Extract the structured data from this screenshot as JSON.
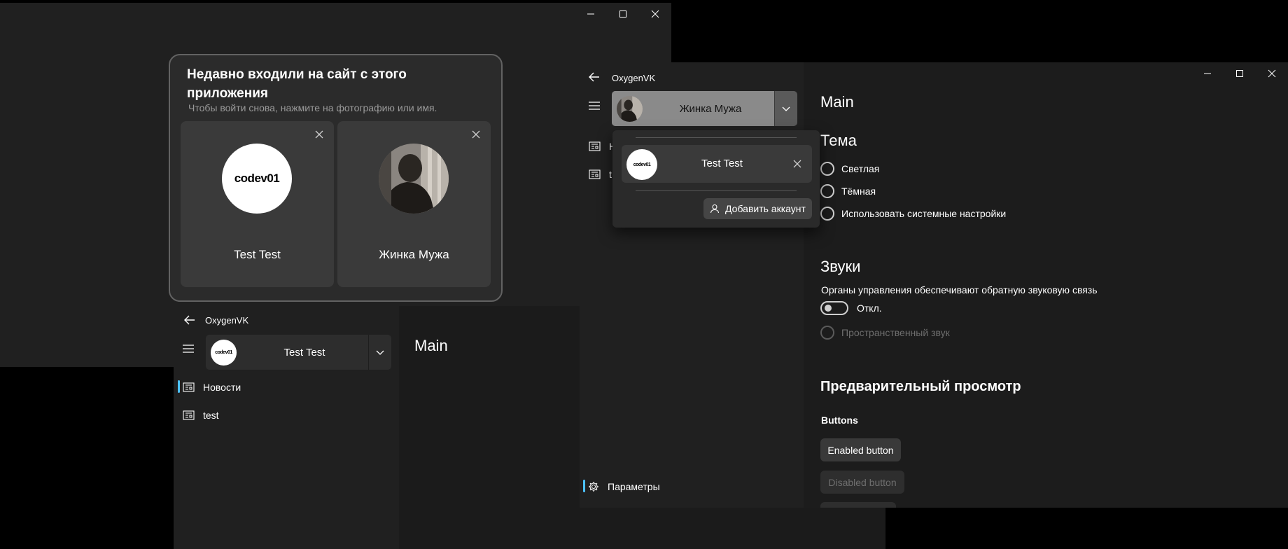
{
  "window1": {
    "caption": {
      "minimize": "minimize-icon",
      "maximize": "maximize-icon",
      "close": "close-icon"
    },
    "login": {
      "title": "Недавно входили на сайт с этого приложения",
      "subtitle": "Чтобы войти снова, нажмите на фотографию или имя.",
      "accounts": [
        {
          "name": "Test Test",
          "avatar_text": "codev01"
        },
        {
          "name": "Жинка Мужа",
          "avatar_text": ""
        }
      ]
    }
  },
  "window2": {
    "app_title": "OxygenVK",
    "account": {
      "name": "Test Test",
      "avatar_text": "codev01"
    },
    "nav": [
      {
        "label": "Новости",
        "icon": "news-icon",
        "selected": true
      },
      {
        "label": "test",
        "icon": "news-icon",
        "selected": false
      }
    ],
    "page_title": "Main"
  },
  "window3": {
    "app_title": "OxygenVK",
    "account": {
      "name": "Жинка Мужа"
    },
    "nav_partial": [
      "Н",
      "t"
    ],
    "settings_label": "Параметры",
    "flyout": {
      "account": {
        "name": "Test Test",
        "avatar_text": "codev01"
      },
      "add_account_label": "Добавить аккаунт"
    },
    "page_title": "Main",
    "theme": {
      "heading": "Тема",
      "options": [
        "Светлая",
        "Тёмная",
        "Использовать системные настройки"
      ]
    },
    "sounds": {
      "heading": "Звуки",
      "description": "Органы управления обеспечивают обратную звуковую связь",
      "toggle_label": "Откл.",
      "toggle_on": false,
      "spatial_label": "Пространственный звук"
    },
    "preview": {
      "heading": "Предварительный просмотр",
      "buttons_label": "Buttons",
      "enabled_button": "Enabled button",
      "disabled_button": "Disabled button"
    }
  },
  "colors": {
    "accent": "#4cc2ff",
    "background": "#202020",
    "card": "#3a3a3a"
  }
}
